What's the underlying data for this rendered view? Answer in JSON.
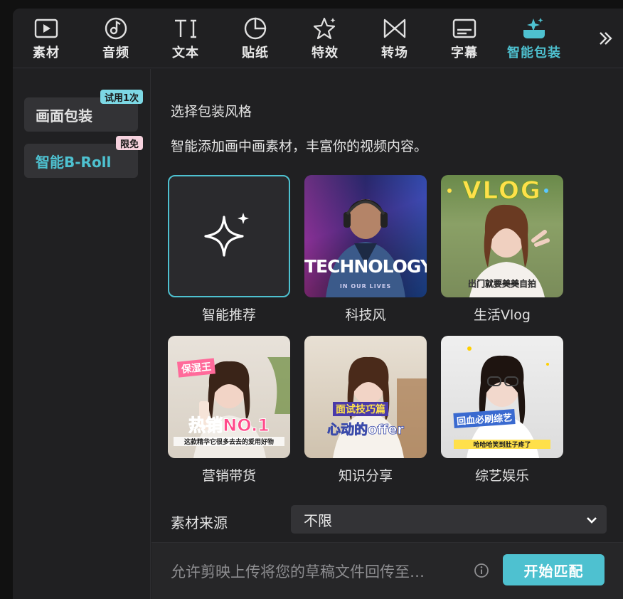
{
  "toolbar": {
    "tabs": [
      {
        "label": "素材",
        "icon": "media-icon"
      },
      {
        "label": "音频",
        "icon": "music-icon"
      },
      {
        "label": "文本",
        "icon": "text-icon"
      },
      {
        "label": "贴纸",
        "icon": "sticker-icon"
      },
      {
        "label": "特效",
        "icon": "effects-star-icon"
      },
      {
        "label": "转场",
        "icon": "transition-icon"
      },
      {
        "label": "字幕",
        "icon": "subtitle-icon"
      },
      {
        "label": "智能包装",
        "icon": "smart-package-icon",
        "active": true
      }
    ],
    "more_icon": "double-chevron-right-icon"
  },
  "sidebar": {
    "items": [
      {
        "label": "画面包装",
        "tag": "试用1次",
        "tag_color": "#7dd8e4",
        "active": false
      },
      {
        "label": "智能B-Roll",
        "tag": "限免",
        "tag_color": "#f6d2de",
        "active": true
      }
    ]
  },
  "main": {
    "section_title": "选择包装风格",
    "description": "智能添加画中画素材，丰富你的视频内容。",
    "styles": [
      {
        "label": "智能推荐",
        "selected": true
      },
      {
        "label": "科技风",
        "thumb_text": "TECHNOLOGY",
        "thumb_sub": "IN OUR LIVES"
      },
      {
        "label": "生活Vlog",
        "thumb_text": "VLOG",
        "thumb_sub": "出门就要美美自拍"
      },
      {
        "label": "营销带货",
        "thumb_text": "热销NO.1",
        "thumb_top": "保湿王",
        "thumb_sub": "这款精华它很多去去的爱用好物"
      },
      {
        "label": "知识分享",
        "thumb_text": "心动的offer",
        "thumb_top": "面试技巧篇"
      },
      {
        "label": "综艺娱乐",
        "thumb_text": "回血必刷综艺",
        "thumb_sub": "哈哈哈笑到肚子疼了"
      }
    ],
    "source_label": "素材来源",
    "source_value": "不限"
  },
  "footer": {
    "consent_text": "允许剪映上传将您的草稿文件回传至…",
    "start_button": "开始匹配"
  },
  "colors": {
    "accent": "#4ec1d0",
    "panel_bg": "#202022",
    "control_bg": "#333336"
  }
}
